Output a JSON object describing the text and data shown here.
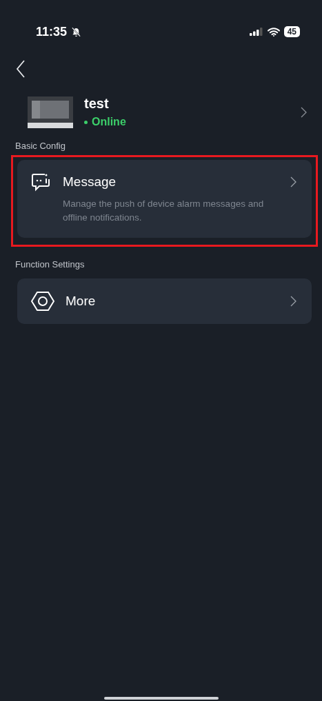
{
  "status_bar": {
    "time": "11:35",
    "battery": "45"
  },
  "device": {
    "name": "test",
    "status": "Online",
    "online": true
  },
  "sections": [
    {
      "title": "Basic Config",
      "items": [
        {
          "kind": "message",
          "title": "Message",
          "description": "Manage the push of device alarm messages and offline notifications.",
          "highlighted": true
        }
      ]
    },
    {
      "title": "Function Settings",
      "items": [
        {
          "kind": "more",
          "title": "More",
          "highlighted": false
        }
      ]
    }
  ]
}
